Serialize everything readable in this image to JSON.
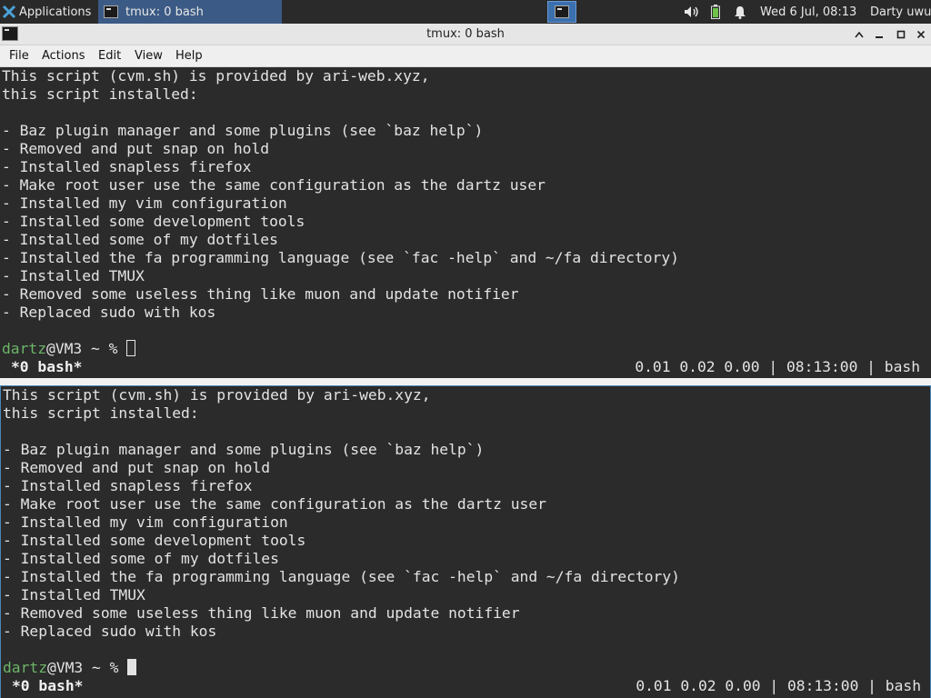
{
  "panel": {
    "apps_label": "Applications",
    "task_label": "tmux: 0 bash",
    "clock": "Wed  6 Jul, 08:13",
    "user": "Darty uwu"
  },
  "window": {
    "title": "tmux: 0 bash",
    "menu": [
      "File",
      "Actions",
      "Edit",
      "View",
      "Help"
    ]
  },
  "terminal": {
    "lines": [
      "This script (cvm.sh) is provided by ari-web.xyz,",
      "this script installed:",
      "",
      "- Baz plugin manager and some plugins (see `baz help`)",
      "- Removed and put snap on hold",
      "- Installed snapless firefox",
      "- Make root user use the same configuration as the dartz user",
      "- Installed my vim configuration",
      "- Installed some development tools",
      "- Installed some of my dotfiles",
      "- Installed the fa programming language (see `fac -help` and ~/fa directory)",
      "- Installed TMUX",
      "- Removed some useless thing like muon and update notifier",
      "- Replaced sudo with kos",
      ""
    ],
    "prompt_user": "dartz",
    "prompt_rest": "@VM3 ~ % ",
    "status_left": "*0 bash*",
    "status_right": "0.01 0.02 0.00 | 08:13:00 | bash"
  },
  "colors": {
    "prompt_green": "#6cb468",
    "active_border": "#4a87b8",
    "taskbar_active": "#3b5a85"
  },
  "icons": [
    "xfce-icon",
    "terminal-icon",
    "volume-icon",
    "battery-icon",
    "bell-icon",
    "chevron-up-icon",
    "minimize-icon",
    "maximize-icon",
    "close-icon"
  ]
}
